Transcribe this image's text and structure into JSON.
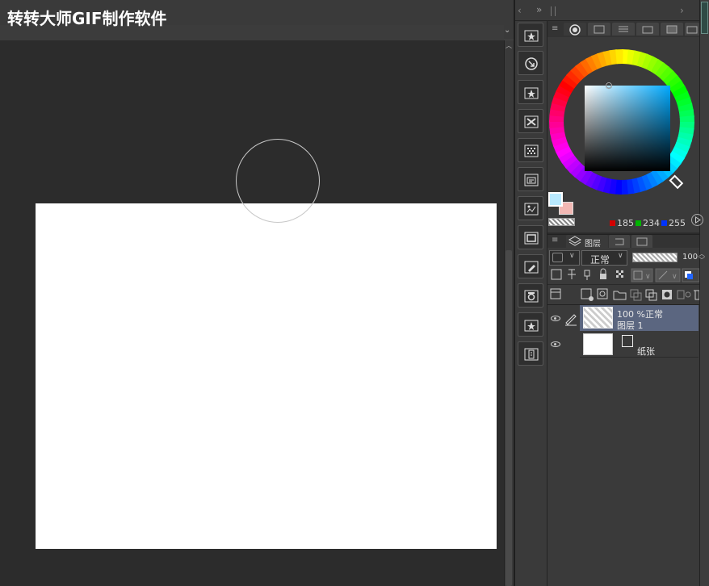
{
  "watermark": "转转大师GIF制作软件",
  "color": {
    "main_swatch": "#b9eaff",
    "sub_swatch": "#f2b8b4",
    "r": "185",
    "g": "234",
    "b": "255"
  },
  "layer_panel": {
    "tab_label": "图层",
    "blend_mode": "正常",
    "opacity": "100"
  },
  "layers": [
    {
      "mode_text": "100 %正常",
      "name": "图层 1"
    },
    {
      "name": "纸张"
    }
  ]
}
